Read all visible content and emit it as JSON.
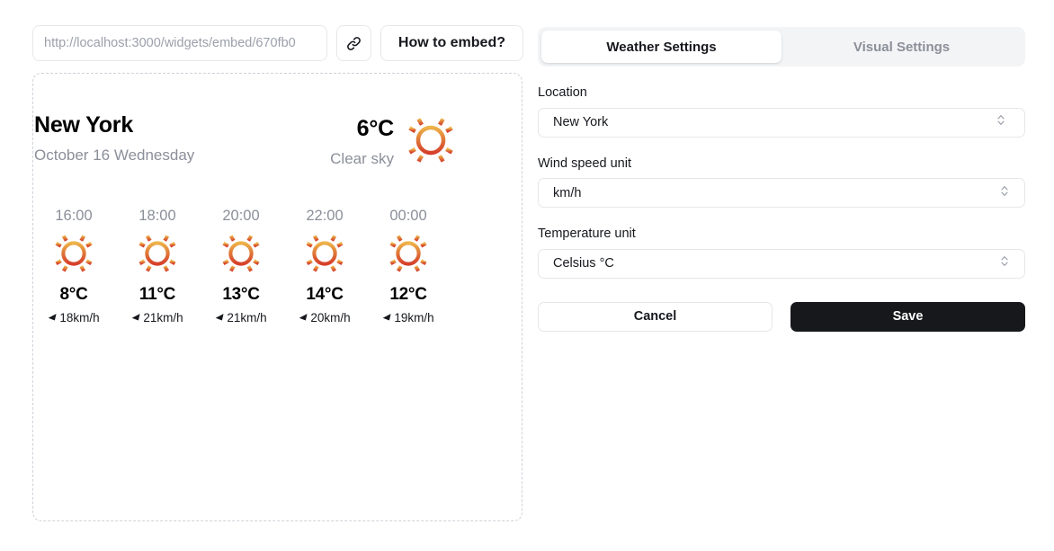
{
  "embed": {
    "url_value": "http://localhost:3000/widgets/embed/670fb0",
    "url_placeholder": "http://localhost:3000/widgets/embed/670fb0",
    "copy_link_icon": "link-icon",
    "how_to_embed_label": "How to embed?"
  },
  "widget": {
    "city": "New York",
    "date": "October 16 Wednesday",
    "current_temperature": "6°C",
    "condition": "Clear sky",
    "condition_icon": "sun-icon",
    "hourly": [
      {
        "time": "16:00",
        "icon": "sun-icon",
        "temperature": "8°C",
        "wind": "18km/h",
        "wind_icon": "wind-direction-arrow-icon"
      },
      {
        "time": "18:00",
        "icon": "sun-icon",
        "temperature": "11°C",
        "wind": "21km/h",
        "wind_icon": "wind-direction-arrow-icon"
      },
      {
        "time": "20:00",
        "icon": "sun-icon",
        "temperature": "13°C",
        "wind": "21km/h",
        "wind_icon": "wind-direction-arrow-icon"
      },
      {
        "time": "22:00",
        "icon": "sun-icon",
        "temperature": "14°C",
        "wind": "20km/h",
        "wind_icon": "wind-direction-arrow-icon"
      },
      {
        "time": "00:00",
        "icon": "sun-icon",
        "temperature": "12°C",
        "wind": "19km/h",
        "wind_icon": "wind-direction-arrow-icon"
      }
    ]
  },
  "settings": {
    "tabs": [
      {
        "label": "Weather Settings",
        "active": true
      },
      {
        "label": "Visual Settings",
        "active": false
      }
    ],
    "fields": [
      {
        "label": "Location",
        "value": "New York"
      },
      {
        "label": "Wind speed unit",
        "value": "km/h"
      },
      {
        "label": "Temperature unit",
        "value": "Celsius °C"
      }
    ],
    "cancel_label": "Cancel",
    "save_label": "Save"
  },
  "colors": {
    "sun_ray_top": "#E8A13C",
    "sun_ray_bottom": "#D94A32",
    "sun_ring": "#E07B39",
    "save_bg": "#17181C",
    "muted_text": "#8B8F99",
    "border": "#E6E7EB",
    "tab_track": "#F3F4F6",
    "dashed_border": "#CFD2D9"
  }
}
